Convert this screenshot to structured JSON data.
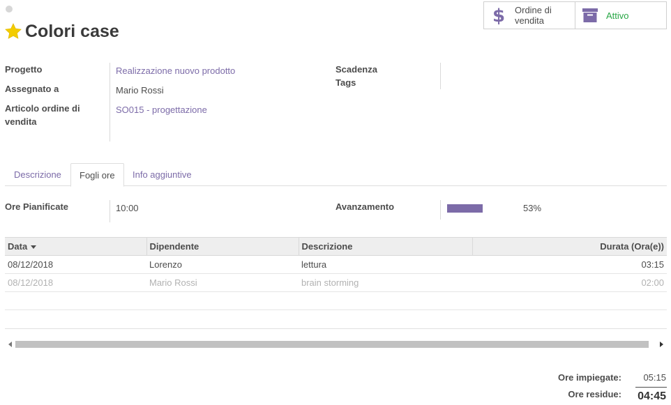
{
  "header": {
    "title": "Colori case",
    "favorite_icon": "star-icon",
    "favorite_color": "#f3cc00"
  },
  "smart_buttons": {
    "sales_order_label": "Ordine di vendita",
    "sales_order_icon": "dollar-icon",
    "active_label": "Attivo",
    "active_icon": "archive-icon",
    "accent_color": "#7c6ba8",
    "active_color": "#28a745"
  },
  "fields": {
    "project_label": "Progetto",
    "project_value": "Realizzazione nuovo prodotto",
    "assigned_label": "Assegnato a",
    "assigned_value": "Mario Rossi",
    "sale_line_label": "Articolo ordine di vendita",
    "sale_line_value": "SO015 - progettazione",
    "deadline_label": "Scadenza",
    "deadline_value": "",
    "tags_label": "Tags",
    "tags_value": ""
  },
  "tabs": [
    {
      "label": "Descrizione",
      "active": false
    },
    {
      "label": "Fogli ore",
      "active": true
    },
    {
      "label": "Info aggiuntive",
      "active": false
    }
  ],
  "timesheet": {
    "planned_label": "Ore Pianificate",
    "planned_value": "10:00",
    "progress_label": "Avanzamento",
    "progress_value": "53%",
    "progress_fraction": 0.53,
    "columns": [
      "Data",
      "Dipendente",
      "Descrizione",
      "Durata (Ora(e))"
    ],
    "rows": [
      {
        "date": "08/12/2018",
        "employee": "Lorenzo",
        "description": "lettura",
        "duration": "03:15"
      },
      {
        "date": "08/12/2018",
        "employee": "Mario Rossi",
        "description": "brain storming",
        "duration": "02:00"
      }
    ]
  },
  "totals": {
    "spent_label": "Ore impiegate:",
    "spent_value": "05:15",
    "remaining_label": "Ore residue:",
    "remaining_value": "04:45"
  }
}
